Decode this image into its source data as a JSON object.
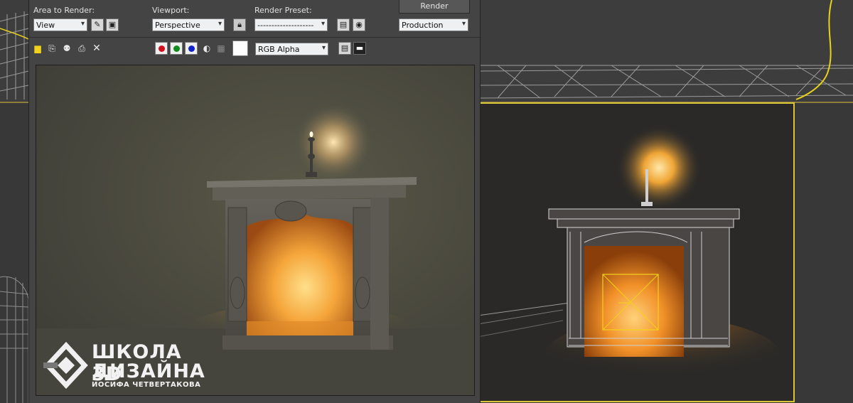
{
  "frame_window": {
    "area_label": "Area to Render:",
    "area_value": "View",
    "viewport_label": "Viewport:",
    "viewport_value": "Perspective",
    "preset_label": "Render Preset:",
    "preset_value": "--------------------",
    "render_button": "Render",
    "production_value": "Production",
    "channel_value": "RGB Alpha"
  },
  "toolbar_icons": [
    "save-icon",
    "copy-icon",
    "clone-icon",
    "print-icon",
    "clear-icon"
  ],
  "channel_colors": {
    "red": "#d0101a",
    "green": "#138a1c",
    "blue": "#1024c8"
  },
  "accent_color": "#d9c53a",
  "watermark": {
    "line1": "ШКОЛА 3D",
    "line2": "ДИЗАЙНА",
    "line3": "ИОСИФА ЧЕТВЕРТАКОВА"
  }
}
